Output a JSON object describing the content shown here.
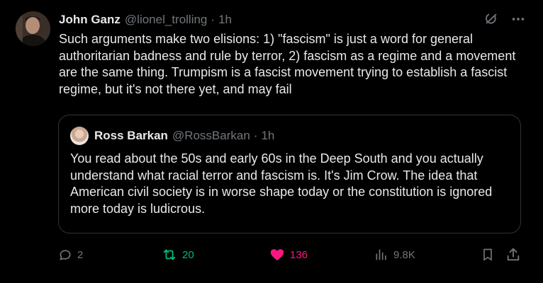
{
  "tweet": {
    "author_name": "John Ganz",
    "author_handle": "@lionel_trolling",
    "separator": "·",
    "time": "1h",
    "text": "Such arguments make two elisions: 1) \"fascism\" is just a word for general authoritarian badness and rule by terror, 2) fascism as a regime and a movement are the same thing. Trumpism is a fascist movement trying to establish a fascist regime, but it's not there yet, and may fail"
  },
  "quoted": {
    "author_name": "Ross Barkan",
    "author_handle": "@RossBarkan",
    "separator": "·",
    "time": "1h",
    "text": "You read about the 50s and early 60s in the Deep South and you actually understand what racial terror and fascism is. It's Jim Crow. The idea that American civil society is in worse shape today or the constitution is ignored more today is ludicrous."
  },
  "actions": {
    "replies": "2",
    "reposts": "20",
    "likes": "136",
    "views": "9.8K"
  },
  "icons": {
    "top": [
      "grok-icon",
      "more-icon"
    ],
    "actions": [
      "reply-icon",
      "repost-icon",
      "like-icon",
      "views-icon",
      "bookmark-icon",
      "share-icon"
    ]
  },
  "colors": {
    "background": "#000000",
    "text": "#e7e9ea",
    "muted": "#71767b",
    "repost": "#00ba7c",
    "like": "#f91880",
    "border": "#2f3336"
  }
}
